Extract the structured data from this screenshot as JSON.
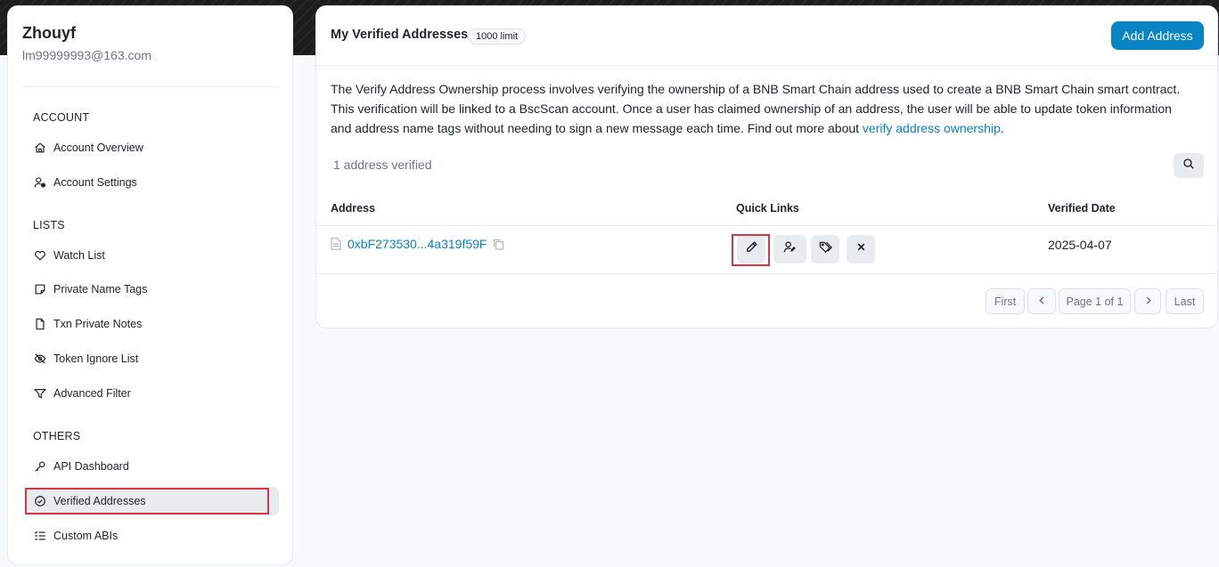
{
  "user": {
    "name": "Zhouyf",
    "email": "lm99999993@163.com"
  },
  "sidebar": {
    "sections": [
      {
        "heading": "ACCOUNT"
      },
      {
        "heading": "LISTS"
      },
      {
        "heading": "OTHERS"
      }
    ],
    "items": [
      {
        "label": "Account Overview",
        "icon": "home-icon"
      },
      {
        "label": "Account Settings",
        "icon": "user-settings-icon"
      },
      {
        "label": "Watch List",
        "icon": "heart-icon"
      },
      {
        "label": "Private Name Tags",
        "icon": "sticky-note-icon"
      },
      {
        "label": "Txn Private Notes",
        "icon": "file-icon"
      },
      {
        "label": "Token Ignore List",
        "icon": "eye-slash-icon"
      },
      {
        "label": "Advanced Filter",
        "icon": "filter-icon"
      },
      {
        "label": "API Dashboard",
        "icon": "key-icon"
      },
      {
        "label": "Verified Addresses",
        "icon": "check-circle-icon",
        "active": true
      },
      {
        "label": "Custom ABIs",
        "icon": "list-check-icon"
      }
    ]
  },
  "main": {
    "title": "My Verified Addresses",
    "limit_badge": "1000 limit",
    "add_button": "Add Address",
    "description": "The Verify Address Ownership process involves verifying the ownership of a BNB Smart Chain address used to create a BNB Smart Chain smart contract. This verification will be linked to a BscScan account. Once a user has claimed ownership of an address, the user will be able to update token information and address name tags without needing to sign a new message each time. Find out more about ",
    "description_link": "verify address ownership",
    "description_end": ".",
    "verified_count": "1 address verified",
    "columns": {
      "address": "Address",
      "quick_links": "Quick Links",
      "verified_date": "Verified Date"
    },
    "rows": [
      {
        "address": "0xbF273530...4a319f59F",
        "verified_date": "2025-04-07"
      }
    ],
    "quick_links": [
      "edit-icon",
      "user-edit-icon",
      "tag-icon",
      "close-icon"
    ],
    "pagination": {
      "first": "First",
      "page_info": "Page 1 of 1",
      "last": "Last"
    }
  },
  "colors": {
    "accent": "#0784c3",
    "highlight": "#dc3545"
  }
}
